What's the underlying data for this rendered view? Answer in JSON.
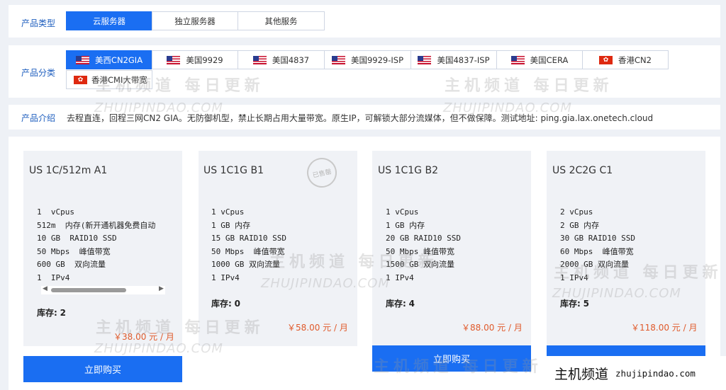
{
  "product_type": {
    "label": "产品类型",
    "tabs": [
      {
        "label": "云服务器",
        "active": true
      },
      {
        "label": "独立服务器",
        "active": false
      },
      {
        "label": "其他服务",
        "active": false
      }
    ]
  },
  "product_category": {
    "label": "产品分类",
    "tabs": [
      {
        "label": "美西CN2GIA",
        "flag": "us-flag-icon",
        "active": true
      },
      {
        "label": "美国9929",
        "flag": "us-flag-icon",
        "active": false
      },
      {
        "label": "美国4837",
        "flag": "us-flag-icon",
        "active": false
      },
      {
        "label": "美国9929-ISP",
        "flag": "us-flag-icon",
        "active": false
      },
      {
        "label": "美国4837-ISP",
        "flag": "us-flag-icon",
        "active": false
      },
      {
        "label": "美国CERA",
        "flag": "us-flag-icon",
        "active": false
      },
      {
        "label": "香港CN2",
        "flag": "hk-flag-icon",
        "active": false
      },
      {
        "label": "香港CMI大带宽",
        "flag": "hk-flag-icon",
        "active": false
      }
    ]
  },
  "intro": {
    "label": "产品介绍",
    "text": "去程直连，回程三网CN2 GIA。无防御机型，禁止长期占用大量带宽。原生IP，可解锁大部分流媒体，但不做保障。测试地址: ping.gia.lax.onetech.cloud"
  },
  "plans": [
    {
      "title": "US 1C/512m A1",
      "specs": [
        "1  vCpus",
        "512m  内存(新开通机器免费自动",
        "10 GB  RAID10 SSD",
        "50 Mbps  峰值带宽",
        "600 GB  双向流量",
        "1  IPv4"
      ],
      "stock_label": "库存:",
      "stock": "2",
      "price": "￥38.00 元 / 月",
      "buy_label": "立即购买",
      "sold_out": false
    },
    {
      "title": "US 1C1G B1",
      "specs": [
        "1 vCpus",
        "1 GB 内存",
        "15 GB RAID10 SSD",
        "50 Mbps  峰值带宽",
        "1000 GB 双向流量",
        "1 IPv4"
      ],
      "stock_label": "库存:",
      "stock": "0",
      "price": "￥58.00 元 / 月",
      "sold_out": true,
      "sold_out_label": "已售罄"
    },
    {
      "title": "US 1C1G B2",
      "specs": [
        "1 vCpus",
        "1 GB 内存",
        "20 GB RAID10 SSD",
        "50 Mbps 峰值带宽",
        "1500 GB 双向流量",
        "1 IPv4"
      ],
      "stock_label": "库存:",
      "stock": "4",
      "price": "￥88.00 元 / 月",
      "buy_label": "立即购买",
      "sold_out": false
    },
    {
      "title": "US 2C2G C1",
      "specs": [
        "2 vCpus",
        "2 GB 内存",
        "30 GB RAID10 SSD",
        "60 Mbps  峰值带宽",
        "2000 GB 双向流量",
        "1 IPv4"
      ],
      "stock_label": "库存:",
      "stock": "5",
      "price": "￥118.00 元 / 月",
      "sold_out": false
    }
  ],
  "watermark": {
    "cn": "主机频道 每日更新",
    "en": "ZHUJIPINDAO.COM"
  },
  "site_badge": {
    "name": "主机频道",
    "url": "zhujipindao.com"
  },
  "colors": {
    "accent": "#1a6ef2",
    "label": "#1f5fbf",
    "price": "#e05a2b"
  }
}
